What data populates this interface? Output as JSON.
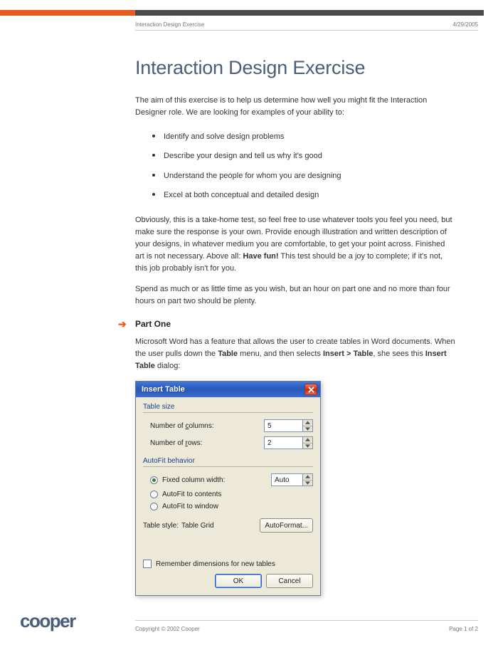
{
  "header": {
    "doc_title": "Interaction Design Exercise",
    "date": "4/29/2005"
  },
  "title": "Interaction Design Exercise",
  "intro": "The aim of this exercise is to help us determine how well you might fit the Interaction Designer role. We are looking for examples of your ability to:",
  "abilities": [
    "Identify and solve design problems",
    "Describe your design and tell us why it's good",
    "Understand the people for whom you are designing",
    "Excel at both conceptual and detailed design"
  ],
  "para2_pre": "Obviously, this is a take-home test, so feel free to use whatever tools you feel you need, but make sure the response is your own. Provide enough illustration and written description of your designs, in whatever medium you are comfortable, to get your point across. Finished art is not necessary. Above all: ",
  "para2_bold": "Have fun!",
  "para2_post": " This test should be a joy to complete; if it's not, this job probably isn't for you.",
  "para3": "Spend as much or as little time as you wish, but an hour on part one and no more than four hours on part two should be plenty.",
  "part_one": {
    "heading": "Part One",
    "text_pre": "Microsoft Word has a feature that allows the user to create tables in Word documents. When the user pulls down the ",
    "bold1": "Table",
    "mid1": " menu, and then selects ",
    "bold2": "Insert > Table",
    "mid2": ", she sees this ",
    "bold3": "Insert Table",
    "text_post": " dialog:"
  },
  "dialog": {
    "title": "Insert Table",
    "group_size": "Table size",
    "cols_label_pre": "Number of ",
    "cols_u": "c",
    "cols_label_post": "olumns:",
    "cols_value": "5",
    "rows_label_pre": "Number of ",
    "rows_u": "r",
    "rows_label_post": "ows:",
    "rows_value": "2",
    "group_autofit": "AutoFit behavior",
    "r1_pre": "Fixed column ",
    "r1_u": "w",
    "r1_post": "idth:",
    "r1_value": "Auto",
    "r2_pre": "Auto",
    "r2_u": "F",
    "r2_post": "it to contents",
    "r3_pre": "AutoFit to win",
    "r3_u": "d",
    "r3_post": "ow",
    "style_label": "Table style:",
    "style_value": "Table Grid",
    "autoformat_pre": "",
    "autoformat_u": "A",
    "autoformat_post": "utoFormat...",
    "remember_pre": "Remember dimen",
    "remember_u": "s",
    "remember_post": "ions for new tables",
    "ok": "OK",
    "cancel": "Cancel"
  },
  "footer": {
    "copyright": "Copyright © 2002 Cooper",
    "page": "Page 1 of 2",
    "logo": "cooper"
  }
}
